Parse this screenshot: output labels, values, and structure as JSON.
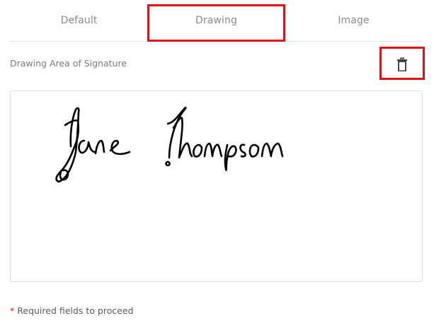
{
  "tabs": [
    {
      "label": "Default"
    },
    {
      "label": "Drawing",
      "active": true
    },
    {
      "label": "Image"
    }
  ],
  "drawing_section": {
    "label": "Drawing Area of Signature",
    "clear_icon": "trash-icon"
  },
  "signature": {
    "text": "Jane Thompson",
    "stroke_color": "#000000"
  },
  "footer": {
    "asterisk": "*",
    "required_text": "Required fields to proceed"
  },
  "colors": {
    "highlight": "#e0101a",
    "tab_text": "#8a8a8a",
    "border": "#dcdcdc"
  }
}
